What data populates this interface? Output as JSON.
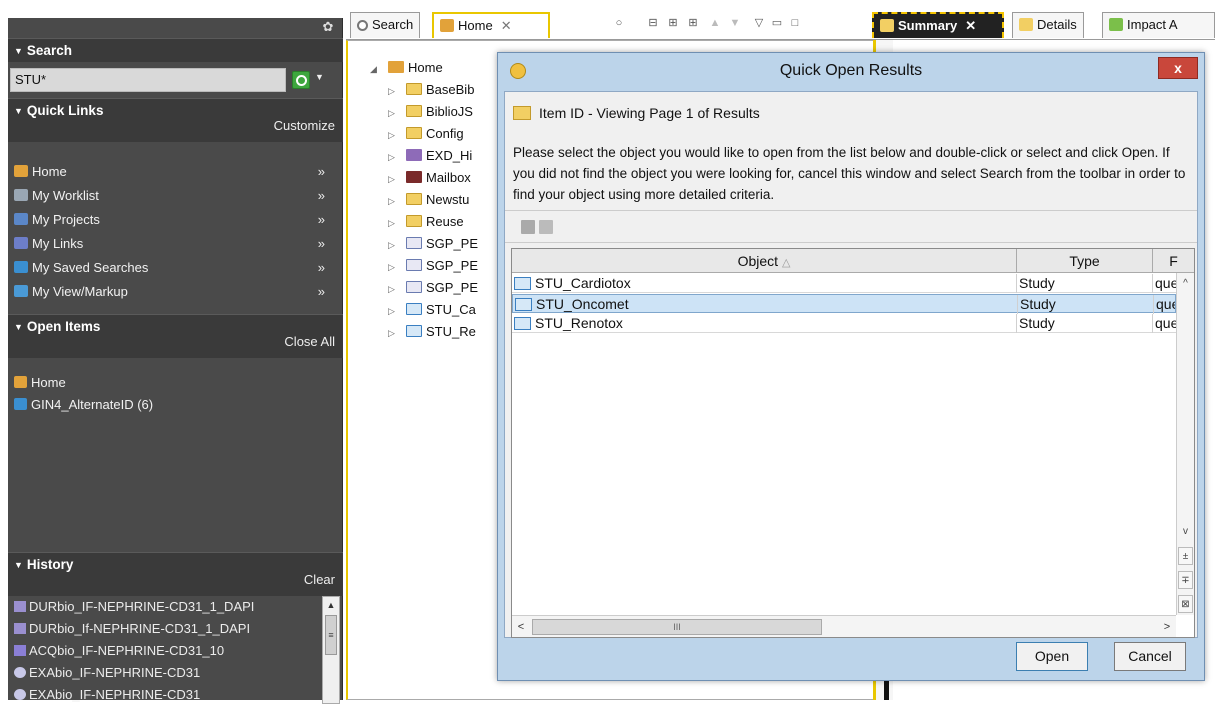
{
  "left": {
    "search": {
      "title": "Search",
      "value": "STU*"
    },
    "quick_links": {
      "title": "Quick Links",
      "action": "Customize",
      "items": [
        {
          "label": "Home",
          "icon": "home-icon",
          "chevron": "»",
          "color": "#e2a23a"
        },
        {
          "label": "My Worklist",
          "icon": "worklist-icon",
          "chevron": "»",
          "color": "#9aa7b4"
        },
        {
          "label": "My Projects",
          "icon": "projects-icon",
          "chevron": "»",
          "color": "#5b87c8"
        },
        {
          "label": "My Links",
          "icon": "links-icon",
          "chevron": "»",
          "color": "#6d7ec9"
        },
        {
          "label": "My Saved Searches",
          "icon": "saved-searches-icon",
          "chevron": "»",
          "color": "#3a8fd1"
        },
        {
          "label": "My View/Markup",
          "icon": "view-markup-icon",
          "chevron": "»",
          "color": "#4a9ad6"
        }
      ]
    },
    "open_items": {
      "title": "Open Items",
      "action": "Close All",
      "items": [
        {
          "label": "Home",
          "icon": "home-icon",
          "color": "#e2a23a"
        },
        {
          "label": "GIN4_AlternateID (6)",
          "icon": "search-result-icon",
          "color": "#3a8fd1"
        }
      ]
    },
    "history": {
      "title": "History",
      "action": "Clear",
      "items": [
        {
          "label": "DURbio_IF-NEPHRINE-CD31_1_DAPI",
          "color": "#9a8fd0"
        },
        {
          "label": "DURbio_If-NEPHRINE-CD31_1_DAPI",
          "color": "#9a8fd0"
        },
        {
          "label": "ACQbio_IF-NEPHRINE-CD31_10",
          "color": "#8b7fd6"
        },
        {
          "label": "EXAbio_IF-NEPHRINE-CD31",
          "color": "#c8c8e8"
        },
        {
          "label": "EXAbio_IF-NEPHRINE-CD31",
          "color": "#c8c8e8"
        }
      ]
    }
  },
  "tabs": {
    "search": "Search",
    "home": "Home",
    "summary": "Summary",
    "details": "Details",
    "impact": "Impact A"
  },
  "tree": {
    "root": "Home",
    "nodes": [
      {
        "label": "BaseBib",
        "type": "folder"
      },
      {
        "label": "BiblioJS",
        "type": "folder"
      },
      {
        "label": "Config",
        "type": "folder"
      },
      {
        "label": "EXD_Hi",
        "type": "lib"
      },
      {
        "label": "Mailbox",
        "type": "mailbox"
      },
      {
        "label": "Newstu",
        "type": "folder"
      },
      {
        "label": "Reuse",
        "type": "folder"
      },
      {
        "label": "SGP_PE",
        "type": "person"
      },
      {
        "label": "SGP_PE",
        "type": "person"
      },
      {
        "label": "SGP_PE",
        "type": "person"
      },
      {
        "label": "STU_Ca",
        "type": "studyf"
      },
      {
        "label": "STU_Re",
        "type": "studyf"
      }
    ]
  },
  "dialog": {
    "title": "Quick Open Results",
    "close": "x",
    "header": "Item ID - Viewing Page 1 of Results",
    "instructions": "Please select the object you would like to open from the list below and double-click or select and click Open. If you did not find the object you were looking for, cancel this window and select Search from the toolbar in order to find your object using more detailed criteria.",
    "columns": {
      "object": "Object",
      "type": "Type",
      "third": "F"
    },
    "rows": [
      {
        "object": "STU_Cardiotox",
        "type": "Study",
        "third": "que"
      },
      {
        "object": "STU_Oncomet",
        "type": "Study",
        "third": "que"
      },
      {
        "object": "STU_Renotox",
        "type": "Study",
        "third": "que"
      }
    ],
    "selected_row": "STU_Oncomet",
    "open_label": "Open",
    "cancel_label": "Cancel"
  }
}
